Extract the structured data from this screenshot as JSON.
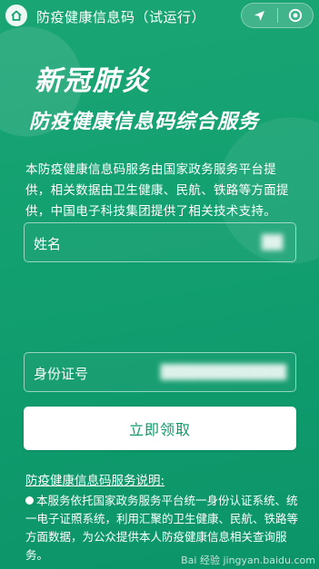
{
  "header": {
    "title": "防疫健康信息码（试运行）",
    "home_icon": "home-icon",
    "location_icon": "location-arrow-icon",
    "target_icon": "target-icon"
  },
  "hero": {
    "line1": "新冠肺炎",
    "line2": "防疫健康信息码综合服务"
  },
  "description": "本防疫健康信息码服务由国家政务服务平台提供，相关数据由卫生健康、民航、铁路等方面提供，中国电子科技集团提供了相关技术支持。",
  "form": {
    "name_label": "姓名",
    "name_value": "██",
    "id_label": "身份证号",
    "id_value": "████████████",
    "submit_label": "立即领取"
  },
  "notice": {
    "title": "防疫健康信息码服务说明:",
    "body": "本服务依托国家政务服务平台统一身份认证系统、统一电子证照系统，利用汇聚的卫生健康、民航、铁路等方面数据，为公众提供本人防疫健康信息相关查询服务。"
  },
  "watermark": "Bai 经验 jingyan.baidu.com"
}
